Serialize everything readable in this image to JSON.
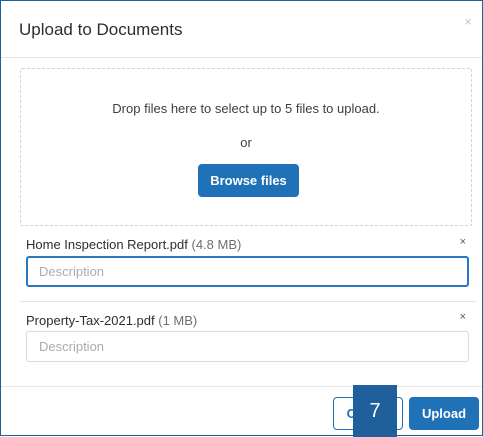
{
  "modal": {
    "title": "Upload to Documents",
    "close_glyph": "×"
  },
  "dropzone": {
    "instruction": "Drop files here to select up to 5 files to upload.",
    "or_text": "or",
    "browse_label": "Browse files"
  },
  "files": [
    {
      "name": "Home Inspection Report.pdf",
      "size": "(4.8 MB)",
      "remove_glyph": "×",
      "description_value": "",
      "description_placeholder": "Description"
    },
    {
      "name": "Property-Tax-2021.pdf",
      "size": "(1 MB)",
      "remove_glyph": "×",
      "description_value": "",
      "description_placeholder": "Description"
    }
  ],
  "footer": {
    "cancel_label": "Cancel",
    "upload_label": "Upload"
  },
  "overlay_badge": "7",
  "colors": {
    "primary": "#1f71b8",
    "frame_border": "#1f5f9b"
  }
}
